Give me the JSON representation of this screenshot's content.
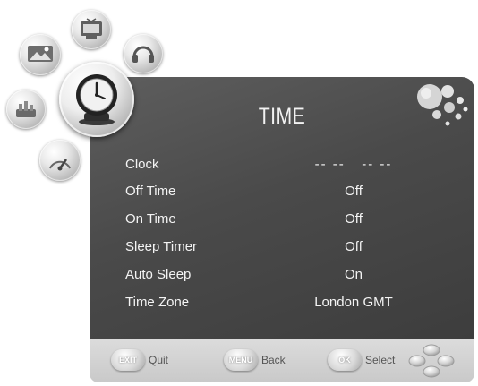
{
  "menu": {
    "title": "TIME",
    "categories": [
      "picture",
      "channel",
      "sound",
      "setup",
      "lock",
      "time"
    ],
    "active_category": "time",
    "items": [
      {
        "label": "Clock",
        "value": "-- --   -- --"
      },
      {
        "label": "Off Time",
        "value": "Off"
      },
      {
        "label": "On Time",
        "value": "Off"
      },
      {
        "label": "Sleep Timer",
        "value": "Off"
      },
      {
        "label": "Auto Sleep",
        "value": "On"
      },
      {
        "label": "Time Zone",
        "value": "London GMT"
      }
    ]
  },
  "footer": {
    "quit": {
      "key": "EXIT",
      "label": "Quit"
    },
    "back": {
      "key": "MENU",
      "label": "Back"
    },
    "select": {
      "key": "OK",
      "label": "Select"
    }
  },
  "colors": {
    "panel": "#4a4a4a",
    "footer": "#d0d0d0",
    "text": "#f4f4f4"
  }
}
